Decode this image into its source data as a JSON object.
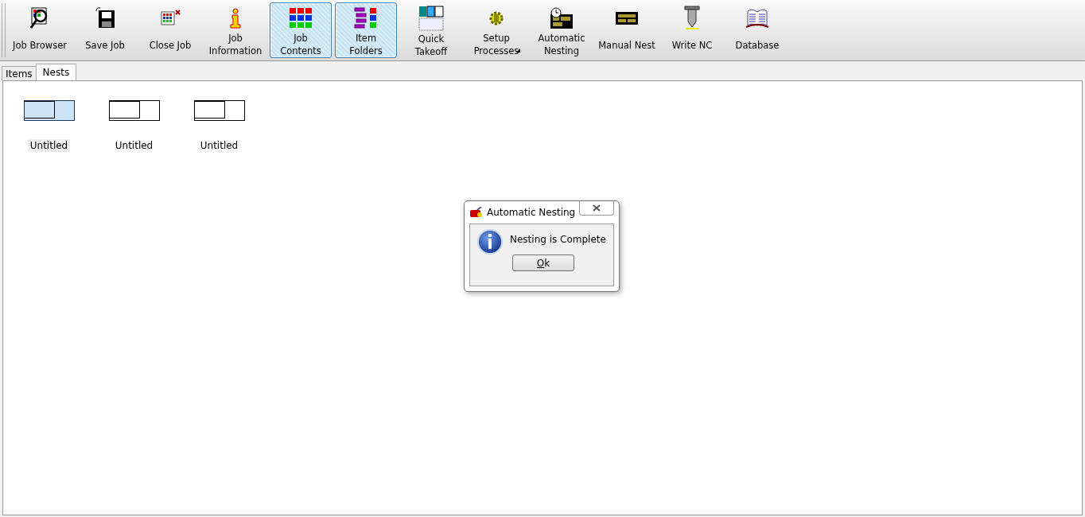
{
  "toolbar": {
    "buttons": [
      {
        "label": "Job Browser",
        "kind": "browser",
        "selected": false,
        "dropdown": false
      },
      {
        "label": "Save Job",
        "kind": "save",
        "selected": false,
        "dropdown": false
      },
      {
        "label": "Close Job",
        "kind": "close",
        "selected": false,
        "dropdown": false
      },
      {
        "label": "Job Information",
        "kind": "info",
        "selected": false,
        "dropdown": false
      },
      {
        "label": "Job Contents",
        "kind": "grid",
        "selected": true,
        "dropdown": false
      },
      {
        "label": "Item Folders",
        "kind": "folders",
        "selected": true,
        "dropdown": false
      },
      {
        "label": "Quick Takeoff",
        "kind": "takeoff",
        "selected": false,
        "dropdown": false
      },
      {
        "label": "Setup Processes",
        "kind": "gear",
        "selected": false,
        "dropdown": true
      },
      {
        "label": "Automatic Nesting",
        "kind": "autonest",
        "selected": false,
        "dropdown": false
      },
      {
        "label": "Manual Nest",
        "kind": "manualnest",
        "selected": false,
        "dropdown": false
      },
      {
        "label": "Write NC",
        "kind": "tool",
        "selected": false,
        "dropdown": false
      },
      {
        "label": "Database",
        "kind": "book",
        "selected": false,
        "dropdown": false
      }
    ]
  },
  "tabs": [
    {
      "label": "Items",
      "selected": false
    },
    {
      "label": "Nests",
      "selected": true
    }
  ],
  "nests": [
    {
      "label": "Untitled",
      "selected": true
    },
    {
      "label": "Untitled",
      "selected": false
    },
    {
      "label": "Untitled",
      "selected": false
    }
  ],
  "dialog": {
    "title": "Automatic Nesting",
    "message": "Nesting is Complete",
    "button": {
      "label": "Ok",
      "mnemonic_underlined": true
    }
  }
}
